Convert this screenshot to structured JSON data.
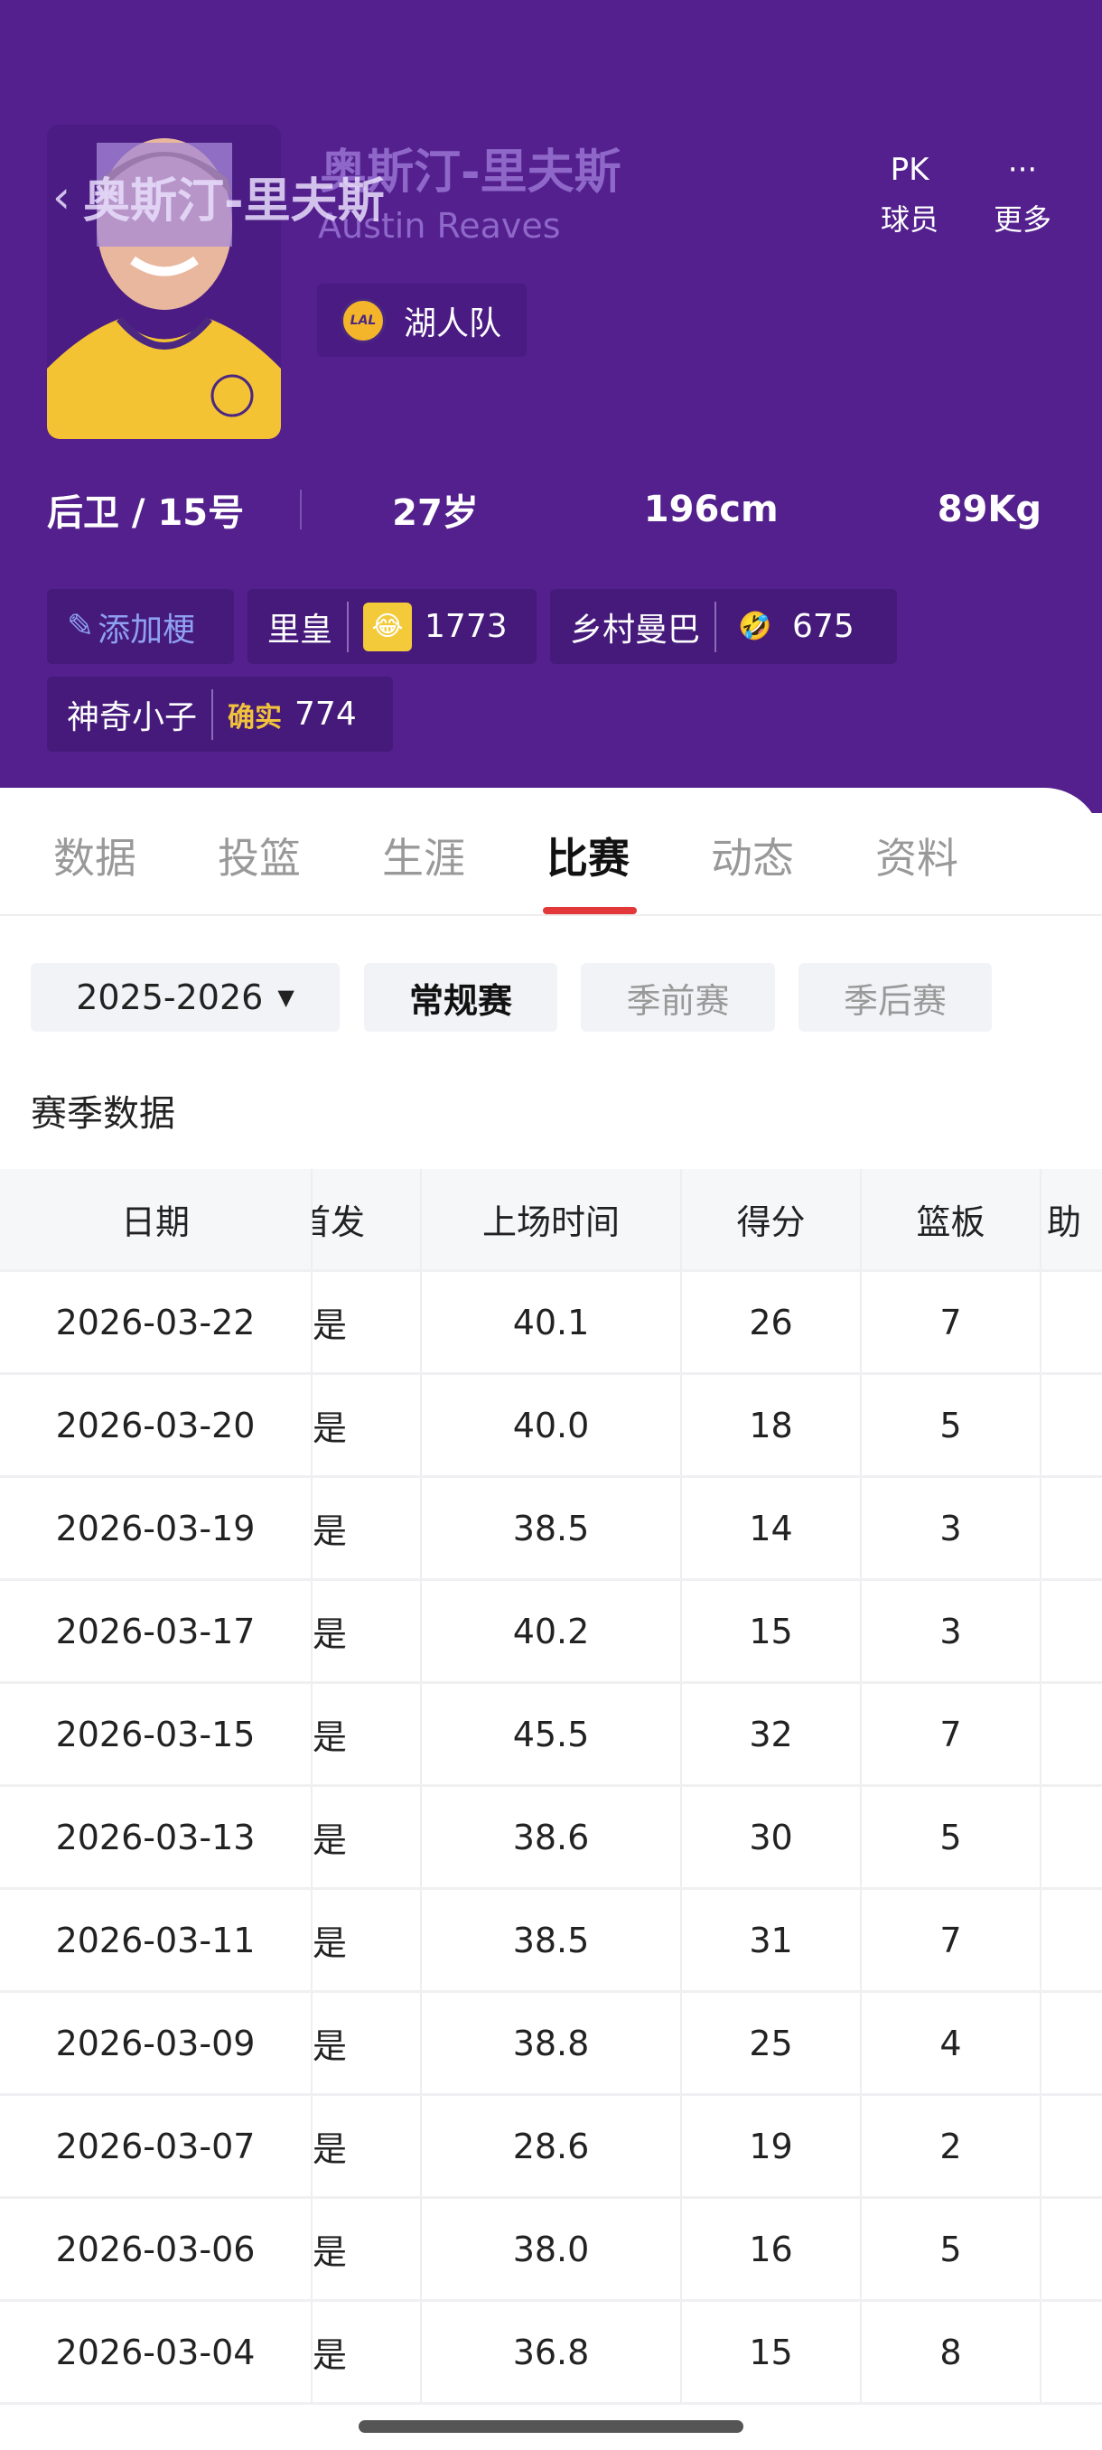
{
  "header": {
    "title": "奥斯汀-里夫斯",
    "name_cn": "奥斯汀-里夫斯",
    "name_en": "Austin Reaves",
    "team": "湖人队",
    "team_logo_text": "LAL",
    "actions": [
      {
        "icon": "PK",
        "label": "球员"
      },
      {
        "icon": "···",
        "label": "更多"
      }
    ],
    "stats": {
      "position": "后卫 / 15号",
      "age": "27岁",
      "height": "196cm",
      "weight": "89Kg"
    },
    "tags": [
      {
        "label": "添加梗"
      },
      {
        "label": "里皇",
        "count": "1773"
      },
      {
        "label": "乡村曼巴",
        "count": "675"
      },
      {
        "label": "神奇小子",
        "stamp": "确实",
        "count": "774"
      }
    ],
    "brand_color": "#53208d"
  },
  "tabs": [
    "数据",
    "投篮",
    "生涯",
    "比赛",
    "动态",
    "资料"
  ],
  "active_tab": "比赛",
  "filters": {
    "season": "2025-2026",
    "types": [
      "常规赛",
      "季前赛",
      "季后赛"
    ],
    "active_type": "常规赛"
  },
  "section_title": "赛季数据",
  "table": {
    "columns": [
      "日期",
      "首发",
      "上场时间",
      "得分",
      "篮板",
      "助"
    ],
    "rows": [
      [
        "2026-03-22",
        "是",
        "40.1",
        "26",
        "7"
      ],
      [
        "2026-03-20",
        "是",
        "40.0",
        "18",
        "5"
      ],
      [
        "2026-03-19",
        "是",
        "38.5",
        "14",
        "3"
      ],
      [
        "2026-03-17",
        "是",
        "40.2",
        "15",
        "3"
      ],
      [
        "2026-03-15",
        "是",
        "45.5",
        "32",
        "7"
      ],
      [
        "2026-03-13",
        "是",
        "38.6",
        "30",
        "5"
      ],
      [
        "2026-03-11",
        "是",
        "38.5",
        "31",
        "7"
      ],
      [
        "2026-03-09",
        "是",
        "38.8",
        "25",
        "4"
      ],
      [
        "2026-03-07",
        "是",
        "28.6",
        "19",
        "2"
      ],
      [
        "2026-03-06",
        "是",
        "38.0",
        "16",
        "5"
      ],
      [
        "2026-03-04",
        "是",
        "36.8",
        "15",
        "8"
      ]
    ]
  }
}
